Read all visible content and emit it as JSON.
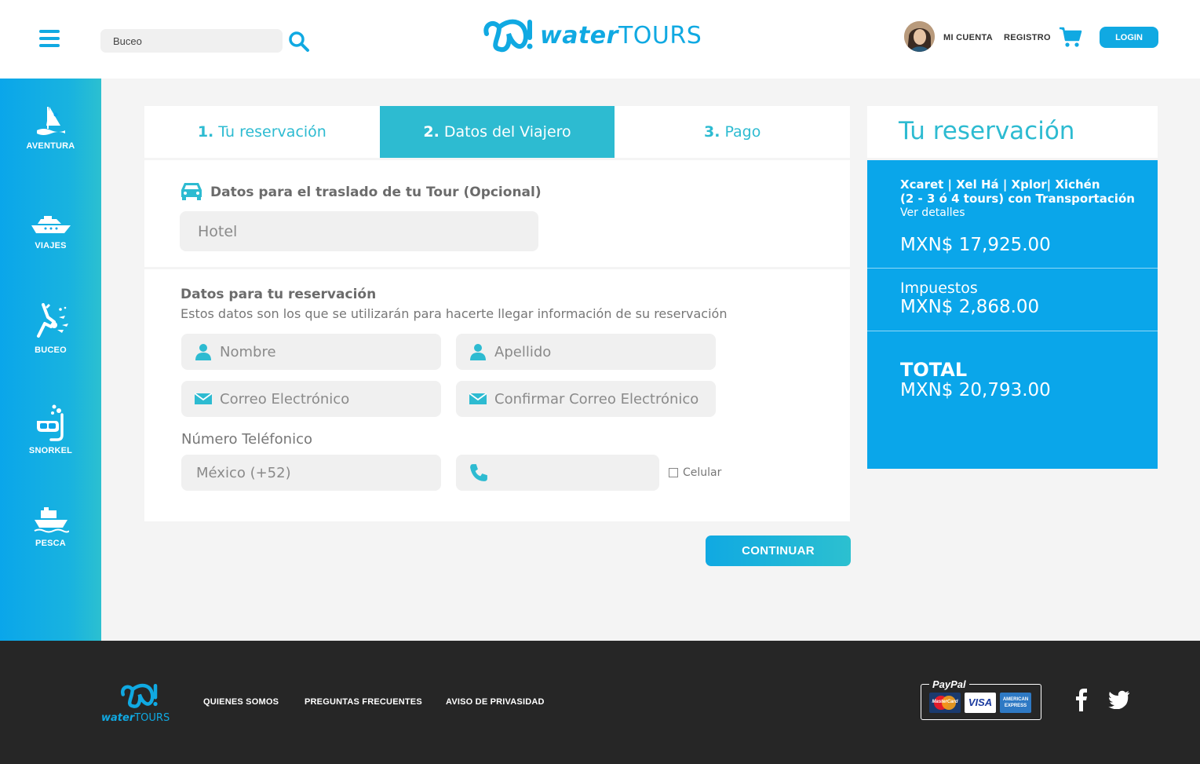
{
  "colors": {
    "primary": "#10a9e2",
    "teal": "#2dbbd1",
    "footer": "#262626"
  },
  "header": {
    "search_value": "Buceo",
    "logo_bold": "water",
    "logo_light": "TOURS",
    "account_label": "MI CUENTA",
    "register_label": "REGISTRO",
    "login_label": "LOGIN"
  },
  "sidebar": {
    "items": [
      {
        "label": "AVENTURA",
        "icon": "windsurf-icon"
      },
      {
        "label": "VIAJES",
        "icon": "boat-icon"
      },
      {
        "label": "BUCEO",
        "icon": "diver-icon"
      },
      {
        "label": "SNORKEL",
        "icon": "snorkel-icon"
      },
      {
        "label": "PESCA",
        "icon": "fishing-boat-icon"
      }
    ]
  },
  "steps": [
    {
      "num": "1.",
      "label": "Tu reservación"
    },
    {
      "num": "2.",
      "label": "Datos del Viajero"
    },
    {
      "num": "3.",
      "label": "Pago"
    }
  ],
  "transfer": {
    "title": "Datos para el traslado de tu Tour (Opcional)",
    "hotel_placeholder": "Hotel"
  },
  "reservation": {
    "title": "Datos para tu reservación",
    "subtitle": "Estos datos son los que se utilizarán para hacerte llegar información de su reservación",
    "name_placeholder": "Nombre",
    "lastname_placeholder": "Apellido",
    "email_placeholder": "Correo Electrónico",
    "confirm_email_placeholder": "Confirmar Correo Electrónico",
    "phone_label": "Número Teléfonico",
    "country_code": "México (+52)",
    "mobile_label": "Celular"
  },
  "continue_label": "CONTINUAR",
  "summary": {
    "title": "Tu reservación",
    "tour_line1": "Xcaret | Xel Há | Xplor| Xichén",
    "tour_line2": "(2 - 3 ó 4 tours) con Transportación",
    "details_link": "Ver detalles",
    "price": "MXN$ 17,925.00",
    "tax_label": "Impuestos",
    "tax_value": "MXN$ 2,868.00",
    "total_label": "TOTAL",
    "total_value": "MXN$ 20,793.00"
  },
  "footer": {
    "logo_bold": "water",
    "logo_light": "TOURS",
    "links": [
      "QUIENES SOMOS",
      "PREGUNTAS FRECUENTES",
      "AVISO DE PRIVASIDAD"
    ],
    "paypal": "PayPal",
    "cards": [
      "MasterCard",
      "VISA",
      "AMERICAN EXPRESS"
    ]
  }
}
